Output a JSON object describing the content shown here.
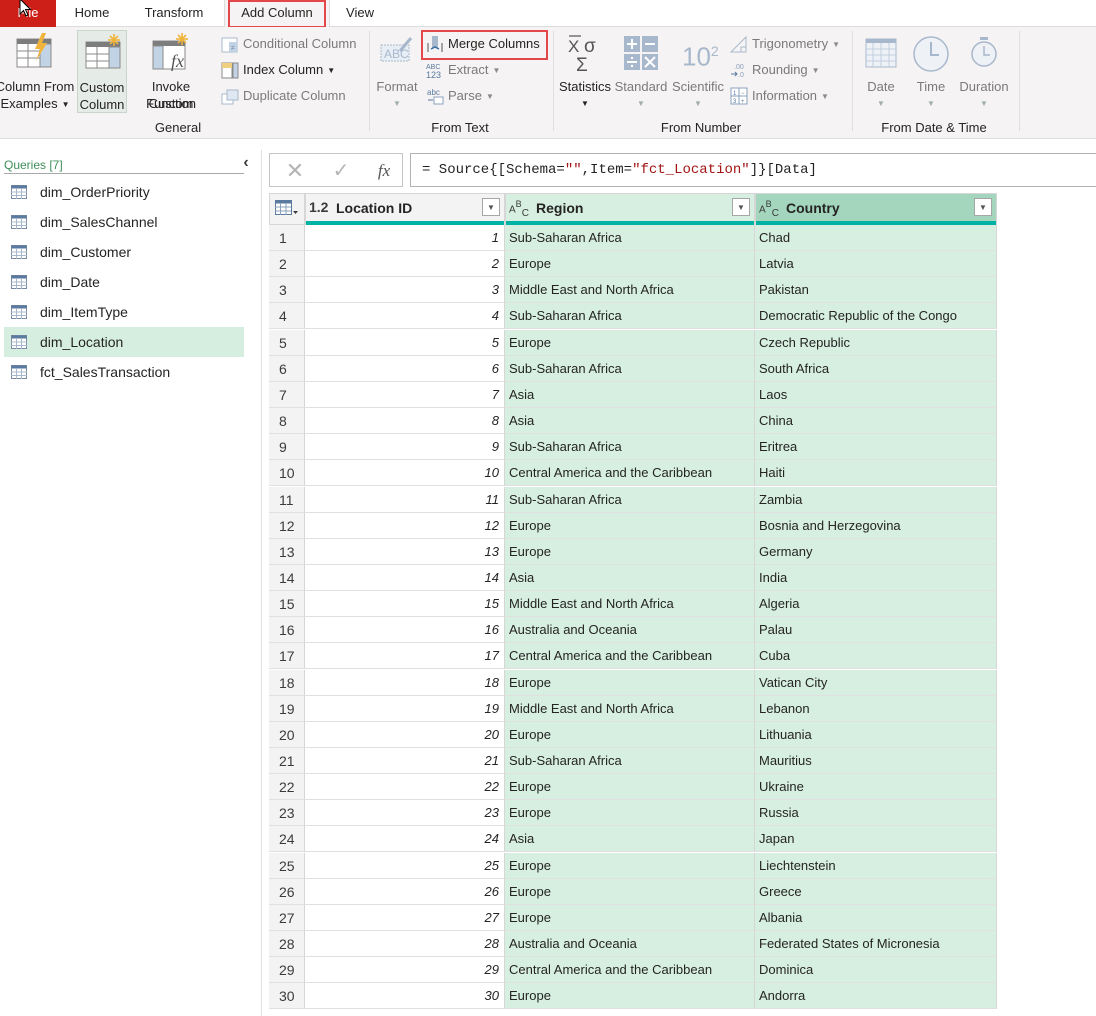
{
  "tabs": {
    "file": "File",
    "home": "Home",
    "transform": "Transform",
    "add_column": "Add Column",
    "view": "View",
    "active": "Add Column"
  },
  "ribbon": {
    "general": {
      "label": "General",
      "column_from_examples": [
        "Column From",
        "Examples"
      ],
      "custom_column": [
        "Custom",
        "Column"
      ],
      "invoke_custom_function": [
        "Invoke Custom",
        "Function"
      ],
      "conditional_column": "Conditional Column",
      "index_column": "Index Column",
      "duplicate_column": "Duplicate Column"
    },
    "from_text": {
      "label": "From Text",
      "format": "Format",
      "merge_columns": "Merge Columns",
      "extract": "Extract",
      "parse": "Parse"
    },
    "from_number": {
      "label": "From Number",
      "statistics": "Statistics",
      "standard": "Standard",
      "scientific": "Scientific",
      "scientific_icon_text": "10",
      "scientific_icon_sup": "2",
      "trigonometry": "Trigonometry",
      "rounding": "Rounding",
      "information": "Information"
    },
    "from_date_time": {
      "label": "From Date & Time",
      "date": "Date",
      "time": "Time",
      "duration": "Duration"
    }
  },
  "queries": {
    "title": "Queries [7]",
    "items": [
      {
        "name": "dim_OrderPriority",
        "selected": false
      },
      {
        "name": "dim_SalesChannel",
        "selected": false
      },
      {
        "name": "dim_Customer",
        "selected": false
      },
      {
        "name": "dim_Date",
        "selected": false
      },
      {
        "name": "dim_ItemType",
        "selected": false
      },
      {
        "name": "dim_Location",
        "selected": true
      },
      {
        "name": "fct_SalesTransaction",
        "selected": false
      }
    ]
  },
  "formula_bar": {
    "prefix": "= Source{[Schema=",
    "str1": "\"\"",
    "mid": ",Item=",
    "str2": "\"fct_Location\"",
    "suffix": "]}[Data]",
    "fx_label": "fx"
  },
  "grid": {
    "columns": [
      {
        "type": "1.2",
        "name": "Location ID"
      },
      {
        "type": "ABC",
        "name": "Region"
      },
      {
        "type": "ABC",
        "name": "Country"
      }
    ],
    "rows": [
      {
        "n": "1",
        "id": "1",
        "region": "Sub-Saharan Africa",
        "country": "Chad"
      },
      {
        "n": "2",
        "id": "2",
        "region": "Europe",
        "country": "Latvia"
      },
      {
        "n": "3",
        "id": "3",
        "region": "Middle East and North Africa",
        "country": "Pakistan"
      },
      {
        "n": "4",
        "id": "4",
        "region": "Sub-Saharan Africa",
        "country": "Democratic Republic of the Congo"
      },
      {
        "n": "5",
        "id": "5",
        "region": "Europe",
        "country": "Czech Republic"
      },
      {
        "n": "6",
        "id": "6",
        "region": "Sub-Saharan Africa",
        "country": "South Africa"
      },
      {
        "n": "7",
        "id": "7",
        "region": "Asia",
        "country": "Laos"
      },
      {
        "n": "8",
        "id": "8",
        "region": "Asia",
        "country": "China"
      },
      {
        "n": "9",
        "id": "9",
        "region": "Sub-Saharan Africa",
        "country": "Eritrea"
      },
      {
        "n": "10",
        "id": "10",
        "region": "Central America and the Caribbean",
        "country": "Haiti"
      },
      {
        "n": "11",
        "id": "11",
        "region": "Sub-Saharan Africa",
        "country": "Zambia"
      },
      {
        "n": "12",
        "id": "12",
        "region": "Europe",
        "country": "Bosnia and Herzegovina"
      },
      {
        "n": "13",
        "id": "13",
        "region": "Europe",
        "country": "Germany"
      },
      {
        "n": "14",
        "id": "14",
        "region": "Asia",
        "country": "India"
      },
      {
        "n": "15",
        "id": "15",
        "region": "Middle East and North Africa",
        "country": "Algeria"
      },
      {
        "n": "16",
        "id": "16",
        "region": "Australia and Oceania",
        "country": "Palau"
      },
      {
        "n": "17",
        "id": "17",
        "region": "Central America and the Caribbean",
        "country": "Cuba"
      },
      {
        "n": "18",
        "id": "18",
        "region": "Europe",
        "country": "Vatican City"
      },
      {
        "n": "19",
        "id": "19",
        "region": "Middle East and North Africa",
        "country": "Lebanon"
      },
      {
        "n": "20",
        "id": "20",
        "region": "Europe",
        "country": "Lithuania"
      },
      {
        "n": "21",
        "id": "21",
        "region": "Sub-Saharan Africa",
        "country": "Mauritius"
      },
      {
        "n": "22",
        "id": "22",
        "region": "Europe",
        "country": "Ukraine"
      },
      {
        "n": "23",
        "id": "23",
        "region": "Europe",
        "country": "Russia"
      },
      {
        "n": "24",
        "id": "24",
        "region": "Asia",
        "country": "Japan"
      },
      {
        "n": "25",
        "id": "25",
        "region": "Europe",
        "country": "Liechtenstein"
      },
      {
        "n": "26",
        "id": "26",
        "region": "Europe",
        "country": "Greece"
      },
      {
        "n": "27",
        "id": "27",
        "region": "Europe",
        "country": "Albania"
      },
      {
        "n": "28",
        "id": "28",
        "region": "Australia and Oceania",
        "country": "Federated States of Micronesia"
      },
      {
        "n": "29",
        "id": "29",
        "region": "Central America and the Caribbean",
        "country": "Dominica"
      },
      {
        "n": "30",
        "id": "30",
        "region": "Europe",
        "country": "Andorra"
      }
    ]
  },
  "colors": {
    "file_tab": "#cd1f18",
    "highlight_box": "#e4474a",
    "column_quality_bar": "#00b2a3",
    "selected_cell_bg": "#d6efe1",
    "selected_header_bg": "#a3d6bc",
    "formula_string": "#a31515"
  }
}
